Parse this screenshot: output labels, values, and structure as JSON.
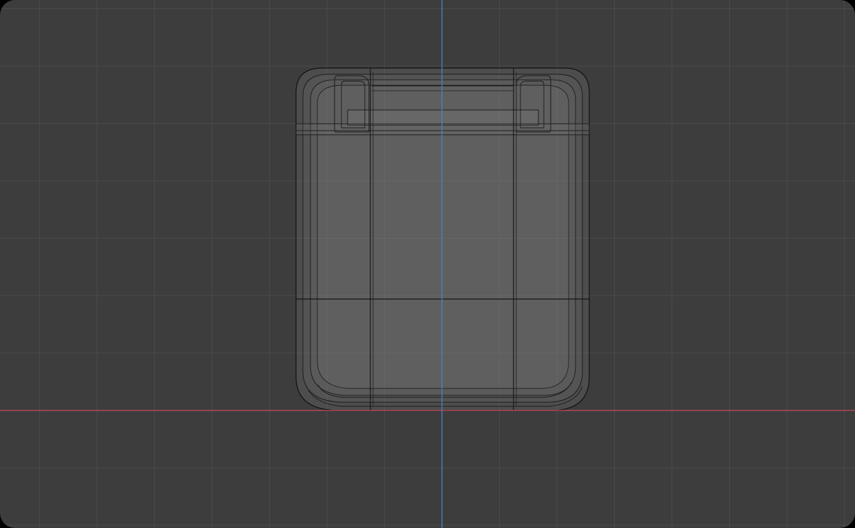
{
  "viewport": {
    "view": "front-orthographic",
    "shading": "x-ray wireframe",
    "colors": {
      "background": "#3d3d3d",
      "grid_line": "#4a4a4a",
      "x_axis": "#c24c5a",
      "z_axis": "#4d7fc8",
      "wire": "#1a1a1a",
      "mesh_fill": "#8c8c8c"
    }
  },
  "mesh": {
    "object": "rounded-box",
    "description_visible": false
  }
}
